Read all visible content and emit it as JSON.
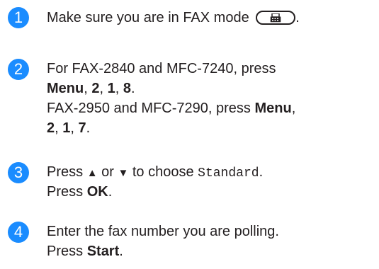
{
  "colors": {
    "badge": "#1a8cff",
    "text": "#231f20"
  },
  "steps": [
    {
      "number": "1",
      "text_before": "Make sure you are in FAX mode",
      "icon": "fax-mode-key-icon",
      "text_after": "."
    },
    {
      "number": "2",
      "l1": "For FAX-2840 and MFC-7240, press",
      "l2_menu": "Menu",
      "l2_sep1": ", ",
      "l2_k1": "2",
      "l2_sep2": ", ",
      "l2_k2": "1",
      "l2_sep3": ", ",
      "l2_k3": "8",
      "l2_end": ".",
      "l3_text": "FAX-2950 and MFC-7290, press ",
      "l3_menu": "Menu",
      "l3_end": ",",
      "l4_k1": "2",
      "l4_sep1": ", ",
      "l4_k2": "1",
      "l4_sep2": ", ",
      "l4_k3": "7",
      "l4_end": "."
    },
    {
      "number": "3",
      "l1_press": "Press ",
      "up_arrow": "▲",
      "l1_or": " or ",
      "down_arrow": "▼",
      "l1_choose": " to choose ",
      "option": "Standard",
      "l1_end": ".",
      "l2_press": "Press ",
      "l2_ok": "OK",
      "l2_end": "."
    },
    {
      "number": "4",
      "l1": "Enter the fax number you are polling.",
      "l2_press": "Press ",
      "l2_start": "Start",
      "l2_end": "."
    }
  ]
}
